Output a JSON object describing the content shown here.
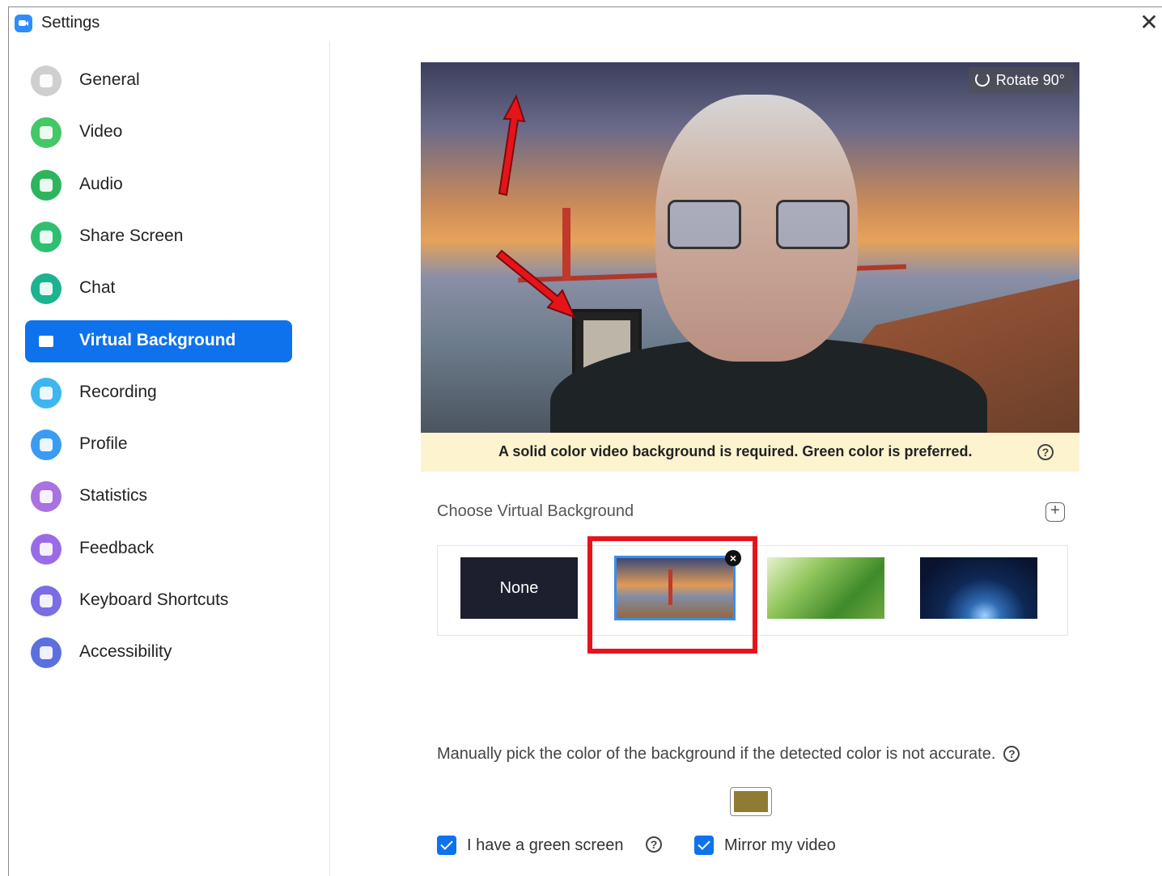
{
  "window": {
    "title": "Settings",
    "close_glyph": "✕"
  },
  "sidebar": {
    "items": [
      {
        "label": "General",
        "icon": "gear-icon",
        "color": "#cfcfcf"
      },
      {
        "label": "Video",
        "icon": "video-camera-icon",
        "color": "#44c767"
      },
      {
        "label": "Audio",
        "icon": "headphones-icon",
        "color": "#2db55d"
      },
      {
        "label": "Share Screen",
        "icon": "share-screen-icon",
        "color": "#2fbf71"
      },
      {
        "label": "Chat",
        "icon": "chat-bubble-icon",
        "color": "#1cb38f"
      },
      {
        "label": "Virtual Background",
        "icon": "person-card-icon",
        "color": "#0e72ed",
        "active": true
      },
      {
        "label": "Recording",
        "icon": "record-icon",
        "color": "#3db6f0"
      },
      {
        "label": "Profile",
        "icon": "user-icon",
        "color": "#3a9bf5"
      },
      {
        "label": "Statistics",
        "icon": "bar-chart-icon",
        "color": "#a872e0"
      },
      {
        "label": "Feedback",
        "icon": "smiley-icon",
        "color": "#9a6be6"
      },
      {
        "label": "Keyboard Shortcuts",
        "icon": "keyboard-icon",
        "color": "#7a6de6"
      },
      {
        "label": "Accessibility",
        "icon": "accessibility-icon",
        "color": "#5c6fe0"
      }
    ]
  },
  "preview": {
    "rotate_label": "Rotate 90°",
    "notice": "A solid color video background is required. Green color is preferred.",
    "help_glyph": "?"
  },
  "backgrounds": {
    "heading": "Choose Virtual Background",
    "add_glyph": "+",
    "none_label": "None",
    "delete_glyph": "×",
    "items": [
      "None",
      "golden-gate-bridge",
      "grass",
      "earth-from-space"
    ],
    "selected": "golden-gate-bridge"
  },
  "manual_color": {
    "text": "Manually pick the color of the background if the detected color is not accurate.",
    "color": "#8f7b34"
  },
  "options": {
    "green_screen_label": "I have a green screen",
    "green_screen_checked": true,
    "mirror_label": "Mirror my video",
    "mirror_checked": true
  },
  "annotations": {
    "highlight_color": "#e5141b"
  }
}
